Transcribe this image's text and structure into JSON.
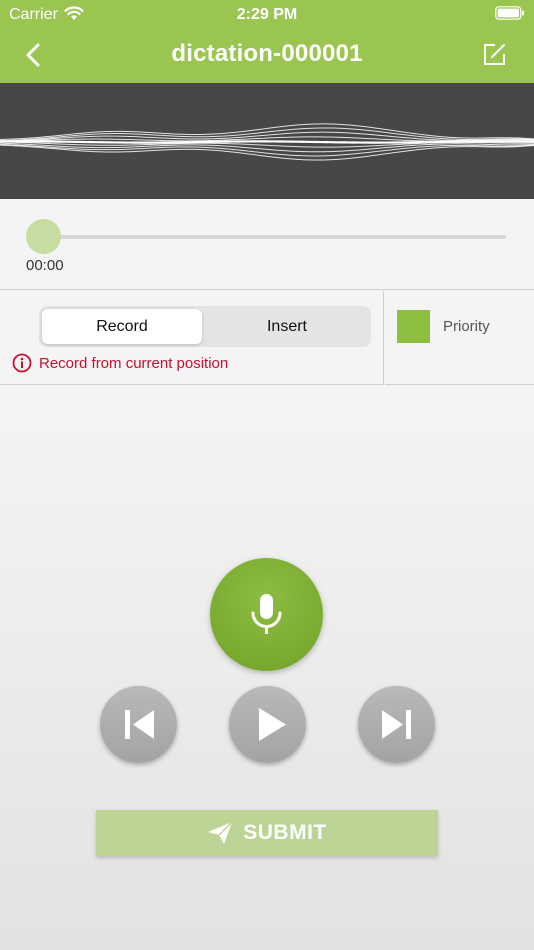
{
  "status_bar": {
    "carrier": "Carrier",
    "time": "2:29 PM"
  },
  "nav": {
    "title": "dictation-000001",
    "back_icon": "chevron-left-icon",
    "edit_icon": "compose-icon"
  },
  "player": {
    "elapsed": "00:00",
    "progress": 0
  },
  "mode": {
    "options": [
      "Record",
      "Insert"
    ],
    "selected": "Record",
    "hint": "Record from current position"
  },
  "priority": {
    "label": "Priority",
    "color": "#8fbf3f"
  },
  "controls": {
    "record_icon": "microphone-icon",
    "prev_icon": "skip-back-icon",
    "play_icon": "play-icon",
    "next_icon": "skip-forward-icon"
  },
  "submit": {
    "label": "SUBMIT",
    "icon": "paper-plane-icon"
  },
  "colors": {
    "accent": "#9bc551",
    "warning": "#c8102e",
    "waveform_bg": "#474747"
  }
}
